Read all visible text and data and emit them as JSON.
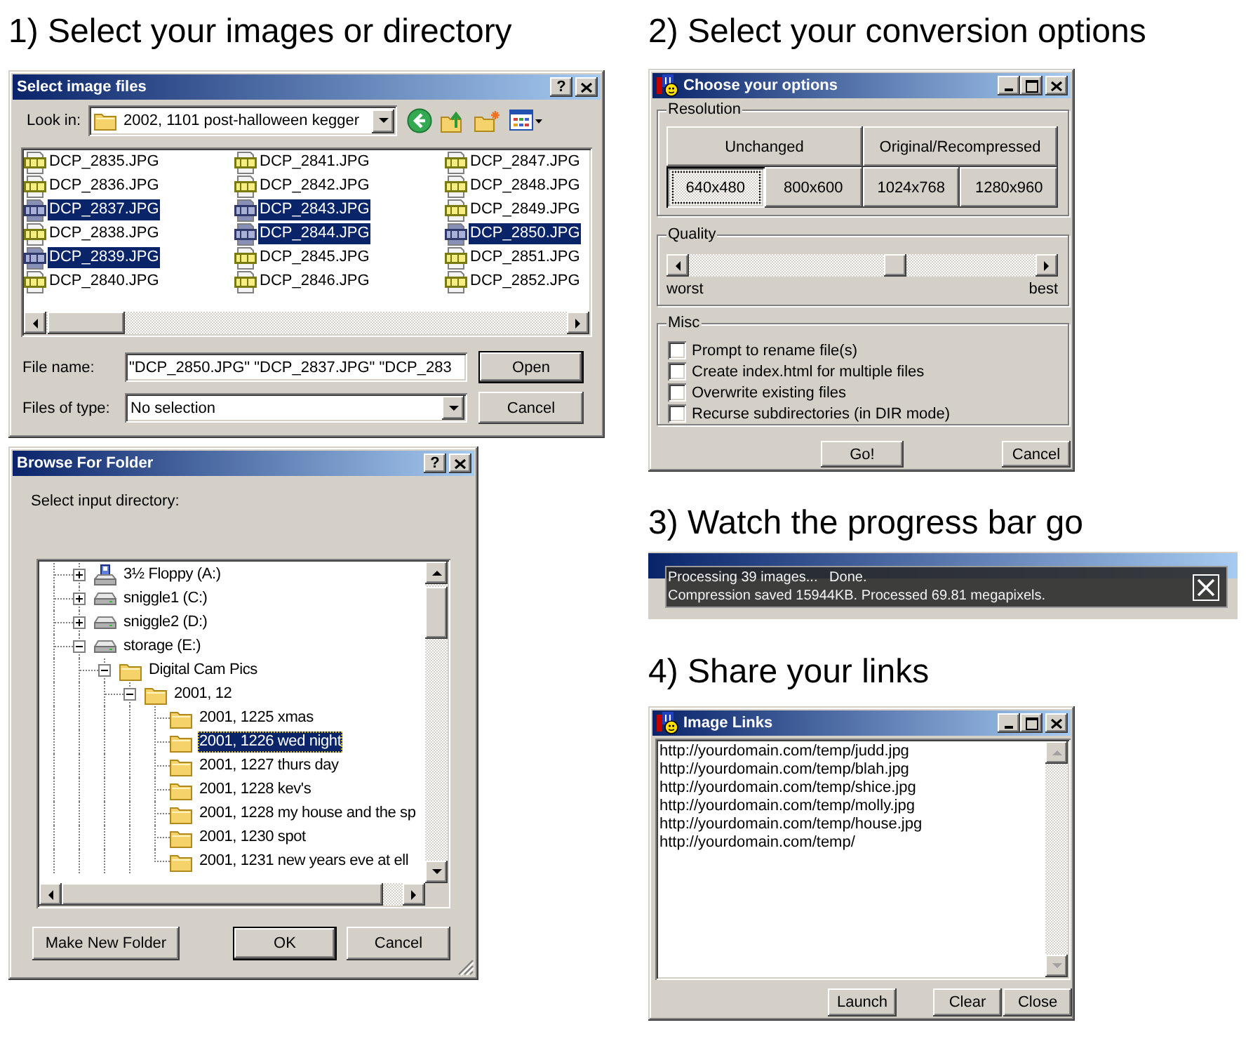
{
  "step1": {
    "heading": "1) Select your images or directory",
    "file_dialog": {
      "title": "Select image files",
      "title_buttons": [
        {
          "kind": "help",
          "glyph": "?"
        },
        {
          "kind": "close"
        }
      ],
      "look_in": {
        "label": "Look in:",
        "value": "2002, 1101 post-halloween kegger"
      },
      "toolbar": [
        {
          "kind": "back"
        },
        {
          "kind": "up"
        },
        {
          "kind": "new_folder"
        },
        {
          "kind": "views"
        }
      ],
      "files": [
        {
          "name": "DCP_2835.JPG",
          "selected": false
        },
        {
          "name": "DCP_2836.JPG",
          "selected": false
        },
        {
          "name": "DCP_2837.JPG",
          "selected": true
        },
        {
          "name": "DCP_2838.JPG",
          "selected": false
        },
        {
          "name": "DCP_2839.JPG",
          "selected": true
        },
        {
          "name": "DCP_2840.JPG",
          "selected": false
        },
        {
          "name": "DCP_2841.JPG",
          "selected": false
        },
        {
          "name": "DCP_2842.JPG",
          "selected": false
        },
        {
          "name": "DCP_2843.JPG",
          "selected": true
        },
        {
          "name": "DCP_2844.JPG",
          "selected": true
        },
        {
          "name": "DCP_2845.JPG",
          "selected": false
        },
        {
          "name": "DCP_2846.JPG",
          "selected": false
        },
        {
          "name": "DCP_2847.JPG",
          "selected": false
        },
        {
          "name": "DCP_2848.JPG",
          "selected": false
        },
        {
          "name": "DCP_2849.JPG",
          "selected": false
        },
        {
          "name": "DCP_2850.JPG",
          "selected": true
        },
        {
          "name": "DCP_2851.JPG",
          "selected": false
        },
        {
          "name": "DCP_2852.JPG",
          "selected": false
        }
      ],
      "file_name": {
        "label": "File name:",
        "value": "\"DCP_2850.JPG\" \"DCP_2837.JPG\" \"DCP_283"
      },
      "file_type": {
        "label": "Files of type:",
        "value": "No selection"
      },
      "buttons": [
        {
          "label": "Open",
          "default": true
        },
        {
          "label": "Cancel",
          "default": false
        }
      ]
    },
    "folder_dialog": {
      "title": "Browse For Folder",
      "title_buttons": [
        {
          "kind": "help",
          "glyph": "?"
        },
        {
          "kind": "close"
        }
      ],
      "prompt": "Select input directory:",
      "tree": [
        {
          "label": "3½ Floppy (A:)",
          "kind": "floppy",
          "expanded": false,
          "selected": false
        },
        {
          "label": "sniggle1 (C:)",
          "kind": "drive",
          "expanded": false,
          "selected": false
        },
        {
          "label": "sniggle2 (D:)",
          "kind": "drive",
          "expanded": false,
          "selected": false
        },
        {
          "label": "storage (E:)",
          "kind": "drive",
          "expanded": true,
          "selected": false,
          "children": [
            {
              "label": "Digital Cam Pics",
              "kind": "folder",
              "expanded": true,
              "selected": false,
              "children": [
                {
                  "label": "2001, 12",
                  "kind": "folder",
                  "expanded": true,
                  "selected": false,
                  "children": [
                    {
                      "label": "2001, 1225 xmas",
                      "kind": "folder",
                      "selected": false
                    },
                    {
                      "label": "2001, 1226 wed night",
                      "kind": "folder",
                      "selected": true
                    },
                    {
                      "label": "2001, 1227 thurs day",
                      "kind": "folder",
                      "selected": false
                    },
                    {
                      "label": "2001, 1228 kev's",
                      "kind": "folder",
                      "selected": false
                    },
                    {
                      "label": "2001, 1228 my house and the sp",
                      "kind": "folder",
                      "selected": false
                    },
                    {
                      "label": "2001, 1230 spot",
                      "kind": "folder",
                      "selected": false
                    },
                    {
                      "label": "2001, 1231 new years eve at ell",
                      "kind": "folder",
                      "selected": false
                    }
                  ]
                }
              ]
            }
          ]
        }
      ],
      "buttons": [
        {
          "label": "Make New Folder",
          "default": false
        },
        {
          "label": "OK",
          "default": true
        },
        {
          "label": "Cancel",
          "default": false
        }
      ]
    }
  },
  "step2": {
    "heading": "2) Select your conversion options",
    "options_dialog": {
      "title": "Choose your options",
      "app_icon": true,
      "title_buttons": [
        {
          "kind": "minimize"
        },
        {
          "kind": "maximize"
        },
        {
          "kind": "close"
        }
      ],
      "resolution": {
        "label": "Resolution",
        "modes": [
          {
            "label": "Unchanged",
            "selected": false
          },
          {
            "label": "Original/Recompressed",
            "selected": false
          }
        ],
        "sizes": [
          {
            "label": "640x480",
            "selected": true
          },
          {
            "label": "800x600",
            "selected": false
          },
          {
            "label": "1024x768",
            "selected": false
          },
          {
            "label": "1280x960",
            "selected": false
          }
        ]
      },
      "quality": {
        "label": "Quality",
        "level": 0.6,
        "min_label": "worst",
        "max_label": "best"
      },
      "misc": {
        "label": "Misc",
        "options": [
          {
            "label": "Prompt to rename file(s)",
            "checked": false
          },
          {
            "label": "Create index.html for multiple files",
            "checked": false
          },
          {
            "label": "Overwrite existing files",
            "checked": false
          },
          {
            "label": "Recurse subdirectories (in DIR mode)",
            "checked": false
          }
        ]
      },
      "buttons": [
        {
          "label": "Go!",
          "default": false
        },
        {
          "label": "Cancel",
          "default": false
        }
      ]
    }
  },
  "step3": {
    "heading": "3) Watch the progress bar go",
    "progress": {
      "lines": [
        "Processing 39 images...   Done.",
        "Compression saved 15944KB. Processed 69.81 megapixels."
      ]
    }
  },
  "step4": {
    "heading": "4) Share your links",
    "links_dialog": {
      "title": "Image Links",
      "app_icon": true,
      "title_buttons": [
        {
          "kind": "minimize"
        },
        {
          "kind": "maximize"
        },
        {
          "kind": "close"
        }
      ],
      "links": [
        "http://yourdomain.com/temp/judd.jpg",
        "http://yourdomain.com/temp/blah.jpg",
        "http://yourdomain.com/temp/shice.jpg",
        "http://yourdomain.com/temp/molly.jpg",
        "http://yourdomain.com/temp/house.jpg",
        "http://yourdomain.com/temp/"
      ],
      "buttons": [
        {
          "label": "Launch",
          "default": false
        },
        {
          "label": "Clear",
          "default": false
        },
        {
          "label": "Close",
          "default": false
        }
      ]
    }
  }
}
